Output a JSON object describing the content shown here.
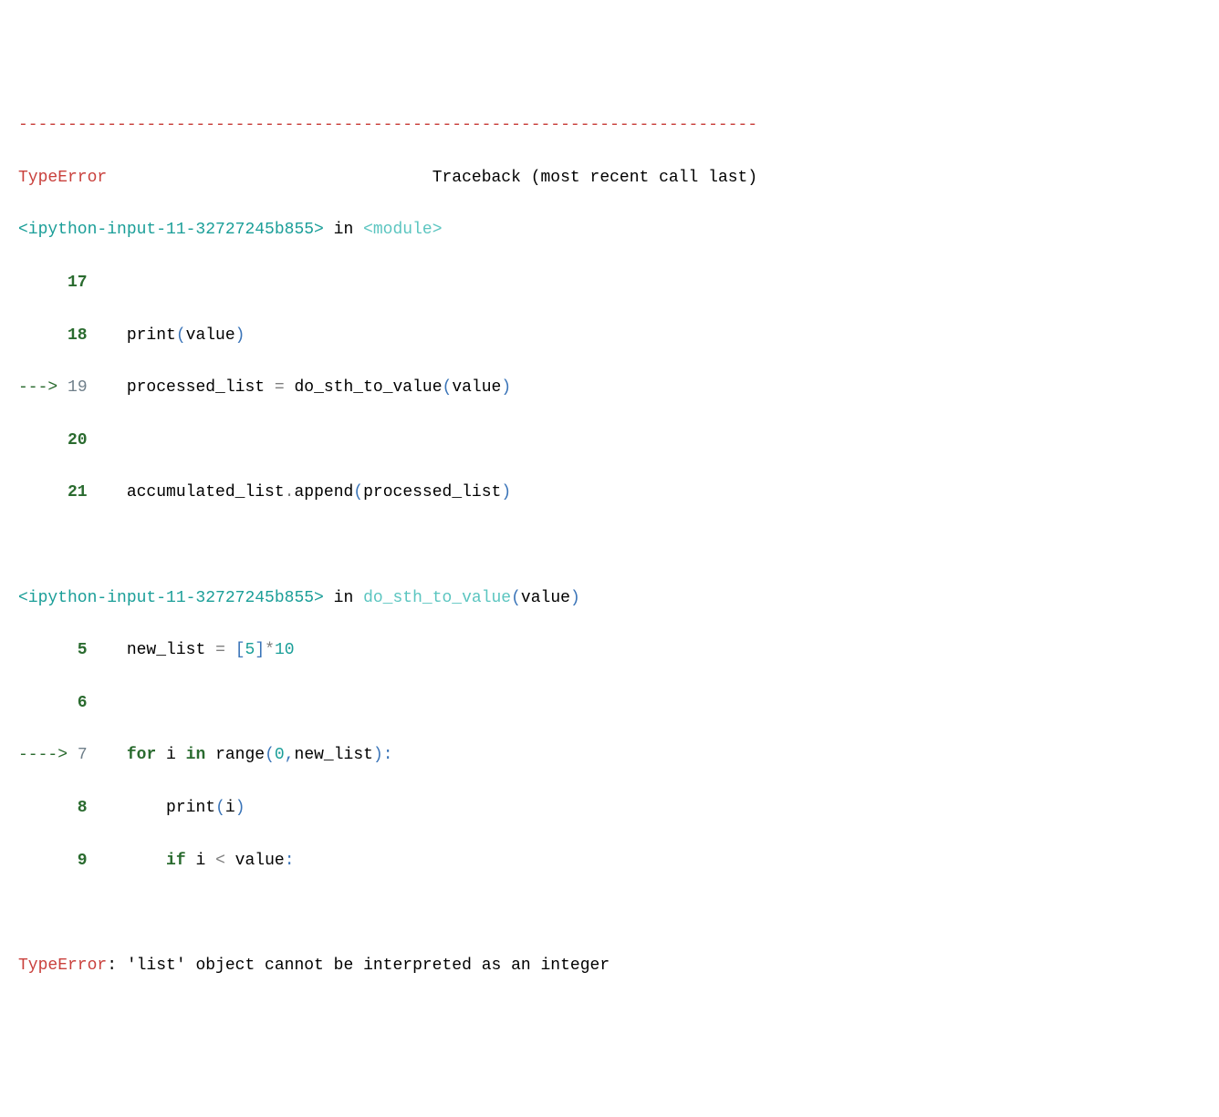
{
  "traceback": {
    "divider": "---------------------------------------------------------------------------",
    "error_name": "TypeError",
    "traceback_label": "Traceback (most recent call last)",
    "frame1": {
      "source": "<ipython-input-11-32727245b855>",
      "in_label": " in ",
      "location": "<module>",
      "lines": {
        "l17_num": "     17",
        "l17_code": "",
        "l18_num": "     18",
        "l18_print": "    print",
        "l18_open": "(",
        "l18_value": "value",
        "l18_close": ")",
        "l19_arrow": "---> ",
        "l19_num": "19",
        "l19_var": "    processed_list ",
        "l19_eq": "=",
        "l19_func": " do_sth_to_value",
        "l19_open": "(",
        "l19_arg": "value",
        "l19_close": ")",
        "l20_num": "     20",
        "l20_code": "",
        "l21_num": "     21",
        "l21_var": "    accumulated_list",
        "l21_dot": ".",
        "l21_method": "append",
        "l21_open": "(",
        "l21_arg": "processed_list",
        "l21_close": ")"
      }
    },
    "frame2": {
      "source": "<ipython-input-11-32727245b855>",
      "in_label": " in ",
      "location_func": "do_sth_to_value",
      "location_open": "(",
      "location_arg": "value",
      "location_close": ")",
      "lines": {
        "l5_num": "      5",
        "l5_var": "    new_list ",
        "l5_eq": "=",
        "l5_space": " ",
        "l5_open": "[",
        "l5_val": "5",
        "l5_close": "]",
        "l5_mult": "*",
        "l5_ten": "10",
        "l6_num": "      6",
        "l6_code": "",
        "l7_arrow": "----> ",
        "l7_num": "7",
        "l7_pad": "    ",
        "l7_for": "for",
        "l7_i": " i ",
        "l7_in": "in",
        "l7_range": " range",
        "l7_open": "(",
        "l7_zero": "0",
        "l7_comma": ",",
        "l7_newlist": "new_list",
        "l7_close": "):",
        "l8_num": "      8",
        "l8_pad": "        print",
        "l8_open": "(",
        "l8_i": "i",
        "l8_close": ")",
        "l9_num": "      9",
        "l9_pad": "        ",
        "l9_if": "if",
        "l9_i": " i ",
        "l9_lt": "<",
        "l9_value": " value",
        "l9_colon": ":"
      }
    },
    "final_error": "TypeError",
    "final_colon": ": ",
    "final_message": "'list' object cannot be interpreted as an integer"
  }
}
